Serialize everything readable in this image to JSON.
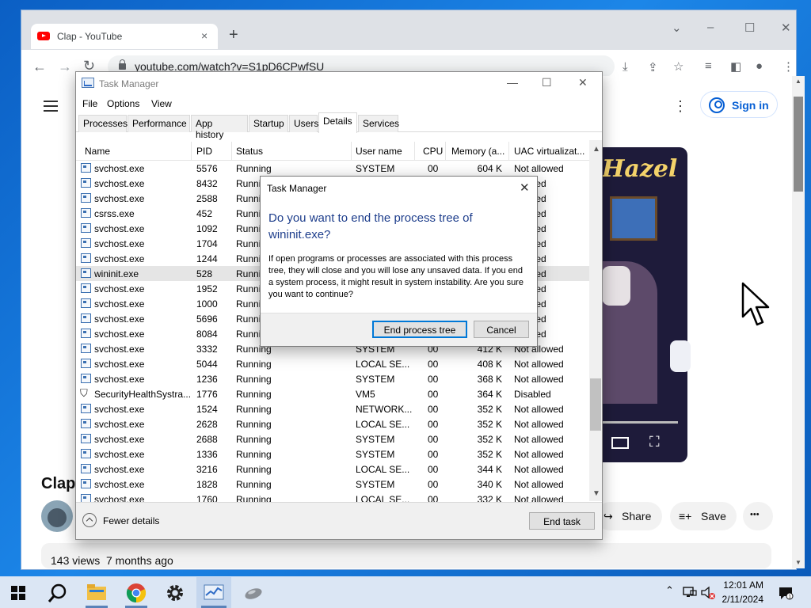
{
  "browser": {
    "tab_title": "Clap - YouTube",
    "url": "youtube.com/watch?v=S1pD6CPwfSU",
    "icons": {
      "tab_close": "×",
      "new_tab": "+",
      "minimize": "–",
      "maximize": "☐",
      "close": "✕",
      "tab_search": "⌄",
      "back": "←",
      "forward": "→",
      "reload": "↻",
      "install": "⤓",
      "share": "⇪",
      "bookmark": "☆",
      "reading_list": "≡",
      "side_panel": "◧",
      "profile": "●",
      "menu": "⋮"
    }
  },
  "youtube": {
    "sign_in": "Sign in",
    "video_overlay_title": "Hazel",
    "video_title": "Clap",
    "share_label": "Share",
    "save_label": "Save",
    "more_label": "•••",
    "views": "143 views",
    "age": "7 months ago",
    "icons": {
      "kebab": "⋮",
      "share": "↪",
      "save": "≡+",
      "fullscreen": "⛶"
    }
  },
  "taskmgr": {
    "title": "Task Manager",
    "window_icons": {
      "minimize": "—",
      "maximize": "☐",
      "close": "✕"
    },
    "menu": [
      "File",
      "Options",
      "View"
    ],
    "tabs": [
      "Processes",
      "Performance",
      "App history",
      "Startup",
      "Users",
      "Details",
      "Services"
    ],
    "active_tab": "Details",
    "columns": [
      "Name",
      "PID",
      "Status",
      "User name",
      "CPU",
      "Memory (a...",
      "UAC virtualizat..."
    ],
    "rows": [
      {
        "name": "svchost.exe",
        "pid": "5576",
        "status": "Running",
        "user": "SYSTEM",
        "cpu": "00",
        "mem": "604 K",
        "uac": "Not allowed"
      },
      {
        "name": "svchost.exe",
        "pid": "8432",
        "status": "Runni",
        "user": "",
        "cpu": "",
        "mem": "",
        "uac": "allowed"
      },
      {
        "name": "svchost.exe",
        "pid": "2588",
        "status": "Runni",
        "user": "",
        "cpu": "",
        "mem": "",
        "uac": "allowed"
      },
      {
        "name": "csrss.exe",
        "pid": "452",
        "status": "Runni",
        "user": "",
        "cpu": "",
        "mem": "",
        "uac": "allowed"
      },
      {
        "name": "svchost.exe",
        "pid": "1092",
        "status": "Runni",
        "user": "",
        "cpu": "",
        "mem": "",
        "uac": "allowed"
      },
      {
        "name": "svchost.exe",
        "pid": "1704",
        "status": "Runni",
        "user": "",
        "cpu": "",
        "mem": "",
        "uac": "allowed"
      },
      {
        "name": "svchost.exe",
        "pid": "1244",
        "status": "Runni",
        "user": "",
        "cpu": "",
        "mem": "",
        "uac": "allowed"
      },
      {
        "name": "wininit.exe",
        "pid": "528",
        "status": "Runni",
        "user": "",
        "cpu": "",
        "mem": "",
        "uac": "allowed"
      },
      {
        "name": "svchost.exe",
        "pid": "1952",
        "status": "Runni",
        "user": "",
        "cpu": "",
        "mem": "",
        "uac": "allowed"
      },
      {
        "name": "svchost.exe",
        "pid": "1000",
        "status": "Runni",
        "user": "",
        "cpu": "",
        "mem": "",
        "uac": "allowed"
      },
      {
        "name": "svchost.exe",
        "pid": "5696",
        "status": "Runni",
        "user": "",
        "cpu": "",
        "mem": "",
        "uac": "allowed"
      },
      {
        "name": "svchost.exe",
        "pid": "8084",
        "status": "Runni",
        "user": "",
        "cpu": "",
        "mem": "",
        "uac": "allowed"
      },
      {
        "name": "svchost.exe",
        "pid": "3332",
        "status": "Running",
        "user": "SYSTEM",
        "cpu": "00",
        "mem": "412 K",
        "uac": "Not allowed"
      },
      {
        "name": "svchost.exe",
        "pid": "5044",
        "status": "Running",
        "user": "LOCAL SE...",
        "cpu": "00",
        "mem": "408 K",
        "uac": "Not allowed"
      },
      {
        "name": "svchost.exe",
        "pid": "1236",
        "status": "Running",
        "user": "SYSTEM",
        "cpu": "00",
        "mem": "368 K",
        "uac": "Not allowed"
      },
      {
        "name": "SecurityHealthSystra...",
        "pid": "1776",
        "status": "Running",
        "user": "VM5",
        "cpu": "00",
        "mem": "364 K",
        "uac": "Disabled"
      },
      {
        "name": "svchost.exe",
        "pid": "1524",
        "status": "Running",
        "user": "NETWORK...",
        "cpu": "00",
        "mem": "352 K",
        "uac": "Not allowed"
      },
      {
        "name": "svchost.exe",
        "pid": "2628",
        "status": "Running",
        "user": "LOCAL SE...",
        "cpu": "00",
        "mem": "352 K",
        "uac": "Not allowed"
      },
      {
        "name": "svchost.exe",
        "pid": "2688",
        "status": "Running",
        "user": "SYSTEM",
        "cpu": "00",
        "mem": "352 K",
        "uac": "Not allowed"
      },
      {
        "name": "svchost.exe",
        "pid": "1336",
        "status": "Running",
        "user": "SYSTEM",
        "cpu": "00",
        "mem": "352 K",
        "uac": "Not allowed"
      },
      {
        "name": "svchost.exe",
        "pid": "3216",
        "status": "Running",
        "user": "LOCAL SE...",
        "cpu": "00",
        "mem": "344 K",
        "uac": "Not allowed"
      },
      {
        "name": "svchost.exe",
        "pid": "1828",
        "status": "Running",
        "user": "SYSTEM",
        "cpu": "00",
        "mem": "340 K",
        "uac": "Not allowed"
      },
      {
        "name": "svchost.exe",
        "pid": "1760",
        "status": "Running",
        "user": "LOCAL SE...",
        "cpu": "00",
        "mem": "332 K",
        "uac": "Not allowed"
      }
    ],
    "selected_process": "wininit.exe",
    "fewer_details": "Fewer details",
    "end_task": "End task"
  },
  "dialog": {
    "title": "Task Manager",
    "close_glyph": "✕",
    "heading": "Do you want to end the process tree of wininit.exe?",
    "body": "If open programs or processes are associated with this process tree, they will close and you will lose any unsaved data. If you end a system process, it might result in system instability. Are you sure you want to continue?",
    "confirm": "End process tree",
    "cancel": "Cancel"
  },
  "taskbar": {
    "time": "12:01 AM",
    "date": "2/11/2024",
    "apps": [
      "start",
      "search",
      "file-explorer",
      "chrome",
      "settings",
      "task-manager",
      "mouse"
    ]
  },
  "colors": {
    "accent": "#0078d7",
    "dialog_heading": "#1e3e8c",
    "youtube_red": "#ff0000",
    "youtube_blue": "#065fd4",
    "taskbar": "#dbe6f4"
  }
}
